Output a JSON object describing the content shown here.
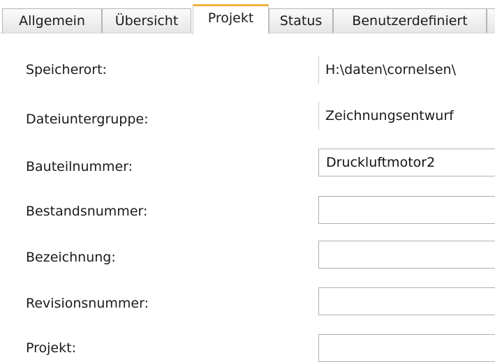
{
  "tabs": [
    {
      "label": "Allgemein",
      "active": false
    },
    {
      "label": "Übersicht",
      "active": false
    },
    {
      "label": "Projekt",
      "active": true
    },
    {
      "label": "Status",
      "active": false
    },
    {
      "label": "Benutzerdefiniert",
      "active": false
    }
  ],
  "accent_color": "#f2b13a",
  "fields": {
    "speicherort": {
      "label": "Speicherort:",
      "value": "H:\\daten\\cornelsen\\"
    },
    "dateiuntergruppe": {
      "label": "Dateiuntergruppe:",
      "value": "Zeichnungsentwurf"
    },
    "bauteilnummer": {
      "label": "Bauteilnummer:",
      "value": "Druckluftmotor2"
    },
    "bestandsnummer": {
      "label": "Bestandsnummer:",
      "value": ""
    },
    "bezeichnung": {
      "label": "Bezeichnung:",
      "value": ""
    },
    "revisionsnummer": {
      "label": "Revisionsnummer:",
      "value": ""
    },
    "projekt": {
      "label": "Projekt:",
      "value": ""
    }
  }
}
